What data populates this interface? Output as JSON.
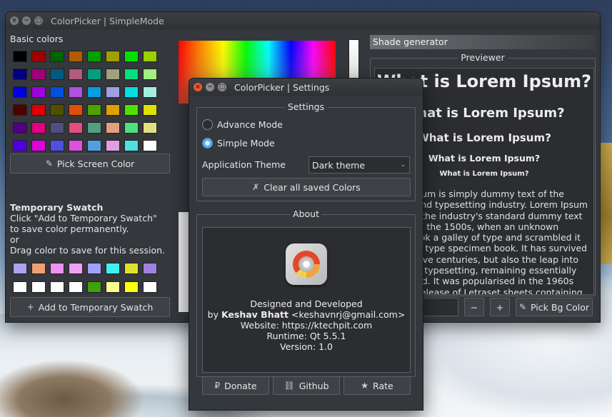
{
  "main": {
    "title": "ColorPicker | SimpleMode",
    "basic_colors_label": "Basic colors",
    "basic_colors": [
      "#000000",
      "#a00000",
      "#006400",
      "#b45a00",
      "#00a000",
      "#a0a000",
      "#00e000",
      "#9ad000",
      "#000080",
      "#a0007a",
      "#005a80",
      "#b45a7a",
      "#00a080",
      "#a0a080",
      "#00e080",
      "#a0f080",
      "#0000e0",
      "#a000e0",
      "#0050e0",
      "#b450e0",
      "#00a0e0",
      "#a0a0e0",
      "#00e0e0",
      "#a0f0e0",
      "#500000",
      "#e00000",
      "#505000",
      "#e05000",
      "#50a000",
      "#e0a000",
      "#50e000",
      "#e0e000",
      "#500080",
      "#e00080",
      "#505080",
      "#e05080",
      "#50a080",
      "#e0a080",
      "#50e080",
      "#e0e080",
      "#5000e0",
      "#e000e0",
      "#5050e0",
      "#e050e0",
      "#50a0e0",
      "#e0a0e0",
      "#50e0e0",
      "#ffffff"
    ],
    "pick_screen_label": "Pick Screen Color",
    "temp_swatch_title": "Temporary Swatch",
    "temp_swatch_lines": [
      "Click \"Add to Temporary Swatch\"",
      "to save color permanently.",
      "or",
      "Drag color to save for this session."
    ],
    "temp_swatches": [
      "#b0a0f0",
      "#f0a070",
      "#f090f0",
      "#f0a0f0",
      "#a0a0ff",
      "#40f0f0",
      "#e0e030",
      "#a080e0",
      "#ffffff",
      "#ffffff",
      "#ffffff",
      "#ffffff",
      "#3fa010",
      "#ffff90",
      "#ffff10",
      "#ffffff"
    ],
    "add_temp_label": "Add to Temporary Swatch",
    "shade_generator_label": "Shade generator",
    "previewer_label": "Previewer",
    "preview_headings": [
      "What is Lorem Ipsum?",
      "What is Lorem Ipsum?",
      "What is Lorem Ipsum?",
      "What is Lorem Ipsum?",
      "What is Lorem Ipsum?"
    ],
    "preview_paragraph": "Lorem Ipsum is simply dummy text of the printing and typesetting industry. Lorem Ipsum has been the industry's standard dummy text ever since the 1500s, when an unknown printer took a galley of type and scrambled it to make a type specimen book. It has survived not only five centuries, but also the leap into electronic typesetting, remaining essentially unchanged. It was popularised in the 1960s with the release of Letraset sheets containing Lorem Ipsum passages",
    "minus_label": "−",
    "plus_label": "+",
    "pick_bg_label": "Pick Bg Color"
  },
  "settings": {
    "title": "ColorPicker | Settings",
    "settings_legend": "Settings",
    "advance_mode_label": "Advance Mode",
    "simple_mode_label": "Simple Mode",
    "app_theme_label": "Application Theme",
    "theme_value": "Dark theme",
    "clear_label": "Clear all saved Colors",
    "about_legend": "About",
    "about_designed": "Designed and Developed",
    "about_by_prefix": "by ",
    "about_author": "Keshav Bhatt",
    "about_email": " <keshavnrj@gmail.com>",
    "about_website": "Website: https://ktechpit.com",
    "about_runtime": "Runtime: Qt 5.5.1",
    "about_version": "Version: 1.0",
    "donate_label": "Donate",
    "github_label": "Github",
    "rate_label": "Rate"
  },
  "colors": {
    "accent": "#5aaee6",
    "close": "#e25b2f",
    "bg": "#34373c"
  }
}
